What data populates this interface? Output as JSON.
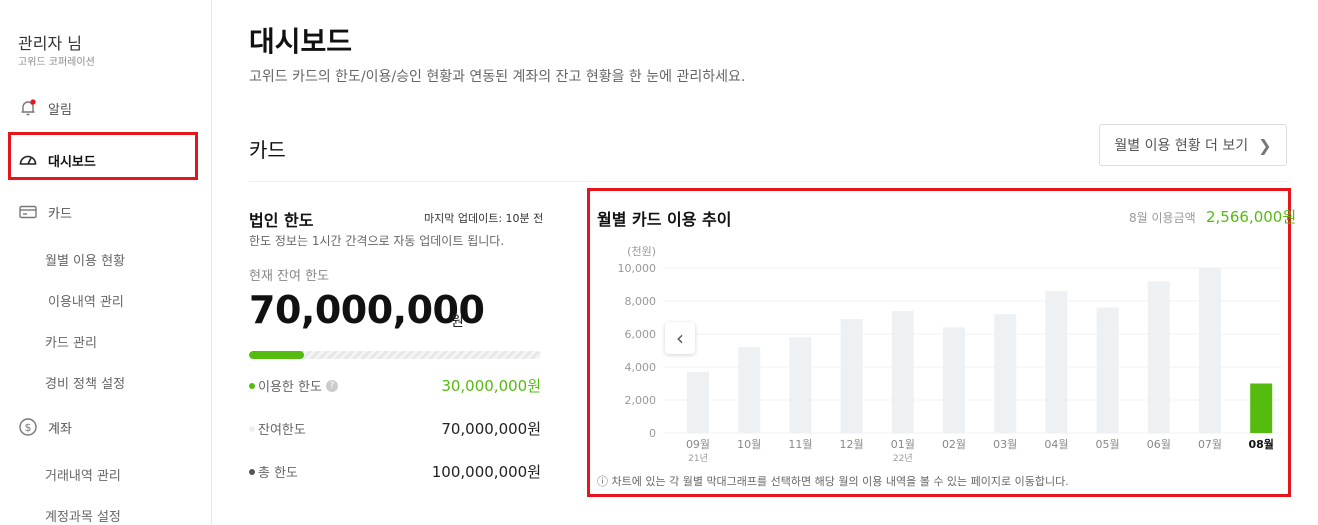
{
  "sidebar": {
    "user_name": "관리자 님",
    "company": "고위드 코퍼레이션",
    "items": [
      {
        "label": "알림",
        "icon": "bell-icon"
      },
      {
        "label": "대시보드",
        "icon": "dashboard-gauge-icon"
      },
      {
        "label": "카드",
        "icon": "card-icon"
      },
      {
        "label": "계좌",
        "icon": "dollar-circle-icon"
      }
    ],
    "card_sub": [
      "월별 이용 현황",
      "이용내역 관리",
      "카드 관리",
      "경비 정책 설정"
    ],
    "account_sub": [
      "거래내역 관리",
      "계정과목 설정"
    ]
  },
  "header": {
    "title": "대시보드",
    "description": "고위드 카드의 한도/이용/승인 현황과 연동된 계좌의 잔고 현황을 한 눈에 관리하세요."
  },
  "card_section": {
    "title": "카드",
    "more_button": "월별 이용 현황 더 보기"
  },
  "limit": {
    "title": "법인 한도",
    "updated": "마지막 업데이트: 10분 전",
    "info": "한도 정보는 1시간 간격으로 자동 업데이트 됩니다.",
    "remaining_label": "현재 잔여 한도",
    "remaining_value": "70,000,000",
    "currency": "원",
    "used_ratio": 0.19,
    "rows": [
      {
        "label": "이용한 한도",
        "value": "30,000,000원",
        "color": "#55bb11"
      },
      {
        "label": "잔여한도",
        "value": "70,000,000원",
        "color": "#eeeeee"
      },
      {
        "label": "총 한도",
        "value": "100,000,000원",
        "color": "#555555"
      }
    ]
  },
  "chart_panel": {
    "title": "월별 카드 이용 추이",
    "month_label": "8월 이용금액",
    "month_amount": "2,566,000원",
    "note": "ⓘ 차트에 있는 각 월별 막대그래프를 선택하면 해당 월의 이용 내역을 볼 수 있는 페이지로 이동합니다."
  },
  "chart_data": {
    "type": "bar",
    "ylabel": "(천원)",
    "ylim": [
      0,
      10000
    ],
    "yticks": [
      "10,000",
      "8,000",
      "6,000",
      "4,000",
      "2,000",
      "0"
    ],
    "categories": [
      "09월",
      "10월",
      "11월",
      "12월",
      "01월",
      "02월",
      "03월",
      "04월",
      "05월",
      "06월",
      "07월",
      "08월"
    ],
    "year_labels": {
      "0": "21년",
      "4": "22년"
    },
    "values": [
      3700,
      5200,
      5800,
      6900,
      7400,
      6400,
      7200,
      8600,
      7600,
      9200,
      10000,
      3000
    ],
    "highlight_index": 11,
    "bar_color": "#eef1f4",
    "highlight_color": "#55bb11"
  }
}
